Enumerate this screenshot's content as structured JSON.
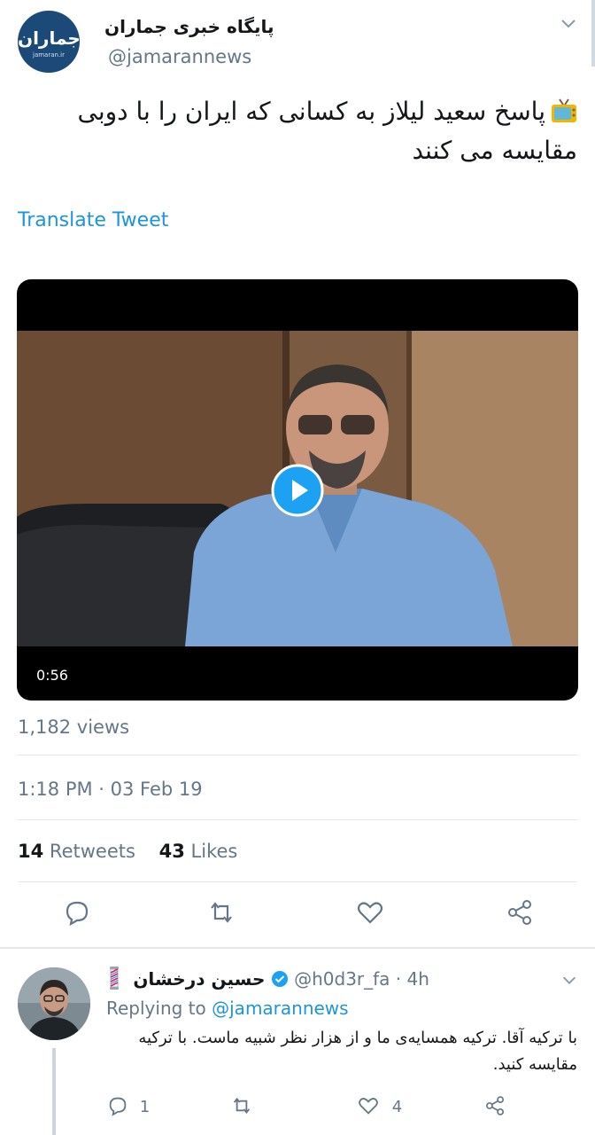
{
  "tweet": {
    "display_name": "پایگاه خبری جماران",
    "handle": "@jamarannews",
    "text": "پاسخ سعید لیلاز به کسانی که ایران را با دوبی مقایسه می کنند",
    "translate_label": "Translate Tweet",
    "video": {
      "duration": "0:56"
    },
    "views": "1,182 views",
    "timestamp": "1:18 PM · 03 Feb 19",
    "retweet_count": "14",
    "retweet_label": "Retweets",
    "like_count": "43",
    "like_label": "Likes"
  },
  "reply": {
    "display_name": "حسین درخشان",
    "handle": "@h0d3r_fa",
    "time": "· 4h",
    "replying_prefix": "Replying to ",
    "replying_handle": "@jamarannews",
    "text": "با ترکیه آقا. ترکیه همسایه‌ی ما و از هزار نظر شبیه ماست. با ترکیه مقایسه کنید.",
    "reply_count": "1",
    "like_count": "4"
  },
  "icons": [
    "chevron-down-icon",
    "tv-icon",
    "play-icon",
    "reply-icon",
    "retweet-icon",
    "like-icon",
    "share-icon",
    "verified-icon",
    "barber-pole-icon"
  ],
  "colors": {
    "accent": "#1b95e0",
    "secondary_text": "#657786",
    "divider": "#e1e8ed"
  }
}
